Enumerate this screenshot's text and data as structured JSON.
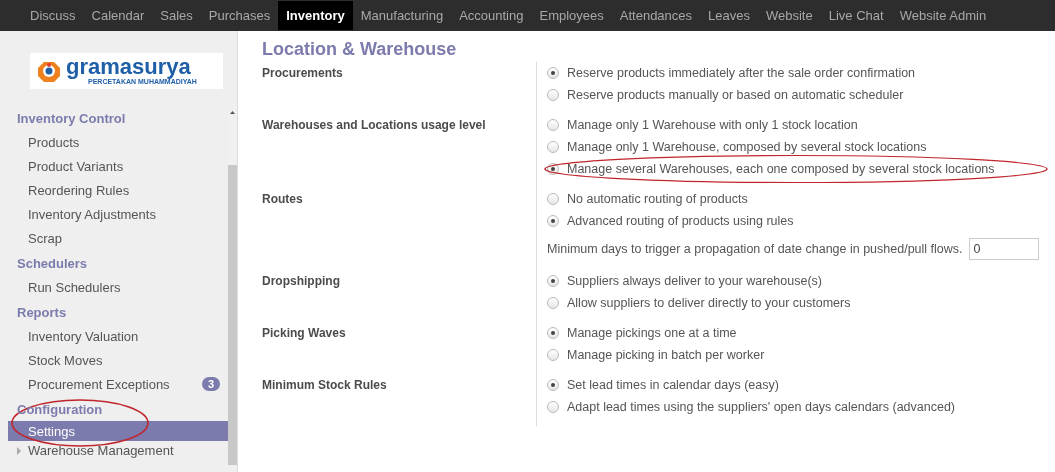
{
  "top_menu": [
    {
      "label": "Discuss",
      "selected": false
    },
    {
      "label": "Calendar",
      "selected": false
    },
    {
      "label": "Sales",
      "selected": false
    },
    {
      "label": "Purchases",
      "selected": false
    },
    {
      "label": "Inventory",
      "selected": true
    },
    {
      "label": "Manufacturing",
      "selected": false
    },
    {
      "label": "Accounting",
      "selected": false
    },
    {
      "label": "Employees",
      "selected": false
    },
    {
      "label": "Attendances",
      "selected": false
    },
    {
      "label": "Leaves",
      "selected": false
    },
    {
      "label": "Website",
      "selected": false
    },
    {
      "label": "Live Chat",
      "selected": false
    },
    {
      "label": "Website Admin",
      "selected": false
    }
  ],
  "sidebar": {
    "logo": {
      "name": "gramasurya",
      "tagline": "PERCETAKAN MUHAMMADIYAH"
    },
    "sections": [
      {
        "title": "Inventory Control",
        "highlighted": false,
        "items": [
          {
            "label": "Products",
            "selected": false
          },
          {
            "label": "Product Variants",
            "selected": false
          },
          {
            "label": "Reordering Rules",
            "selected": false
          },
          {
            "label": "Inventory Adjustments",
            "selected": false
          },
          {
            "label": "Scrap",
            "selected": false
          }
        ]
      },
      {
        "title": "Schedulers",
        "highlighted": false,
        "items": [
          {
            "label": "Run Schedulers",
            "selected": false
          }
        ]
      },
      {
        "title": "Reports",
        "highlighted": false,
        "items": [
          {
            "label": "Inventory Valuation",
            "selected": false
          },
          {
            "label": "Stock Moves",
            "selected": false
          },
          {
            "label": "Procurement Exceptions",
            "selected": false,
            "badge": "3"
          }
        ]
      },
      {
        "title": "Configuration",
        "highlighted": true,
        "items": [
          {
            "label": "Settings",
            "selected": true
          }
        ]
      }
    ],
    "tree_item": {
      "label": "Warehouse Management",
      "expanded": false
    }
  },
  "page": {
    "title": "Location & Warehouse",
    "settings": [
      {
        "label": "Procurements",
        "options": [
          {
            "kind": "radio",
            "label": "Reserve products immediately after the sale order confirmation",
            "selected": true,
            "highlighted": false
          },
          {
            "kind": "radio",
            "label": "Reserve products manually or based on automatic scheduler",
            "selected": false,
            "highlighted": false
          }
        ]
      },
      {
        "label": "Warehouses and Locations usage level",
        "options": [
          {
            "kind": "radio",
            "label": "Manage only 1 Warehouse with only 1 stock location",
            "selected": false,
            "highlighted": false
          },
          {
            "kind": "radio",
            "label": "Manage only 1 Warehouse, composed by several stock locations",
            "selected": false,
            "highlighted": false
          },
          {
            "kind": "radio",
            "label": "Manage several Warehouses, each one composed by several stock locations",
            "selected": true,
            "highlighted": true
          }
        ]
      },
      {
        "label": "Routes",
        "options": [
          {
            "kind": "radio",
            "label": "No automatic routing of products",
            "selected": false,
            "highlighted": false
          },
          {
            "kind": "radio",
            "label": "Advanced routing of products using rules",
            "selected": true,
            "highlighted": false
          },
          {
            "kind": "number",
            "label": "Minimum days to trigger a propagation of date change in pushed/pull flows.",
            "value": "0"
          }
        ]
      },
      {
        "label": "Dropshipping",
        "options": [
          {
            "kind": "radio",
            "label": "Suppliers always deliver to your warehouse(s)",
            "selected": true,
            "highlighted": false
          },
          {
            "kind": "radio",
            "label": "Allow suppliers to deliver directly to your customers",
            "selected": false,
            "highlighted": false
          }
        ]
      },
      {
        "label": "Picking Waves",
        "options": [
          {
            "kind": "radio",
            "label": "Manage pickings one at a time",
            "selected": true,
            "highlighted": false
          },
          {
            "kind": "radio",
            "label": "Manage picking in batch per worker",
            "selected": false,
            "highlighted": false
          }
        ]
      },
      {
        "label": "Minimum Stock Rules",
        "options": [
          {
            "kind": "radio",
            "label": "Set lead times in calendar days (easy)",
            "selected": true,
            "highlighted": false
          },
          {
            "kind": "radio",
            "label": "Adapt lead times using the suppliers' open days calendars (advanced)",
            "selected": false,
            "highlighted": false
          }
        ]
      }
    ]
  }
}
